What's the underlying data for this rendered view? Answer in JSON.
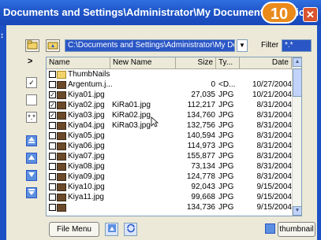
{
  "window": {
    "title": "Documents and Settings\\Administrator\\My Documents\\My Pict",
    "step_badge": "10",
    "close_glyph": "✕",
    "resize_hint": "↕"
  },
  "toolbar": {
    "path_value": "C:\\Documents and Settings\\Administrator\\My Docu",
    "combo_arrow_glyph": "▼",
    "filter_label": "Filter",
    "filter_value": "*.*"
  },
  "sidebar": {
    "arrow_glyph": ">",
    "check_glyph": "✓",
    "wildcard_glyph": "*.*"
  },
  "list": {
    "columns": {
      "name": "Name",
      "new_name": "New Name",
      "size": "Size",
      "type": "Ty...",
      "date": "Date"
    },
    "rows": [
      {
        "checked": false,
        "icon": "folder-icon",
        "name": "ThumbNails",
        "new_name": "",
        "size": "",
        "type": "",
        "date": ""
      },
      {
        "checked": false,
        "icon": "image-icon",
        "name": "Argentum.j...",
        "new_name": "",
        "size": "0",
        "type": "<D...",
        "date": "10/27/2004"
      },
      {
        "checked": true,
        "icon": "image-icon",
        "name": "Kiya01.jpg",
        "new_name": "",
        "size": "27,035",
        "type": "JPG",
        "date": "10/21/2004"
      },
      {
        "checked": true,
        "icon": "image-icon",
        "name": "Kiya02.jpg",
        "new_name": "KiRa01.jpg",
        "size": "112,217",
        "type": "JPG",
        "date": "8/31/2004"
      },
      {
        "checked": true,
        "icon": "image-icon",
        "name": "Kiya03.jpg",
        "new_name": "KiRa02.jpg",
        "size": "134,760",
        "type": "JPG",
        "date": "8/31/2004"
      },
      {
        "checked": false,
        "icon": "image-icon",
        "name": "Kiya04.jpg",
        "new_name": "KiRa03.jpg",
        "size": "132,756",
        "type": "JPG",
        "date": "8/31/2004"
      },
      {
        "checked": false,
        "icon": "image-icon",
        "name": "Kiya05.jpg",
        "new_name": "",
        "size": "140,594",
        "type": "JPG",
        "date": "8/31/2004"
      },
      {
        "checked": false,
        "icon": "image-icon",
        "name": "Kiya06.jpg",
        "new_name": "",
        "size": "114,973",
        "type": "JPG",
        "date": "8/31/2004"
      },
      {
        "checked": false,
        "icon": "image-icon",
        "name": "Kiya07.jpg",
        "new_name": "",
        "size": "155,877",
        "type": "JPG",
        "date": "8/31/2004"
      },
      {
        "checked": false,
        "icon": "image-icon",
        "name": "Kiya08.jpg",
        "new_name": "",
        "size": "73,134",
        "type": "JPG",
        "date": "8/31/2004"
      },
      {
        "checked": false,
        "icon": "image-icon",
        "name": "Kiya09.jpg",
        "new_name": "",
        "size": "124,778",
        "type": "JPG",
        "date": "8/31/2004"
      },
      {
        "checked": false,
        "icon": "image-icon",
        "name": "Kiya10.jpg",
        "new_name": "",
        "size": "92,043",
        "type": "JPG",
        "date": "9/15/2004"
      },
      {
        "checked": false,
        "icon": "image-icon",
        "name": "Kiya11.jpg",
        "new_name": "",
        "size": "99,668",
        "type": "JPG",
        "date": "9/15/2004"
      },
      {
        "checked": false,
        "icon": "image-icon",
        "name": "",
        "new_name": "",
        "size": "134,736",
        "type": "JPG",
        "date": "9/15/2004"
      }
    ],
    "scroll_up_glyph": "▲",
    "scroll_down_glyph": "▼"
  },
  "bottom": {
    "file_menu_label": "File Menu",
    "thumbnail_label": "thumbnail"
  },
  "colors": {
    "title_bar": "#1f56c9",
    "selection": "#2a56c6",
    "badge": "#e98a1b"
  }
}
